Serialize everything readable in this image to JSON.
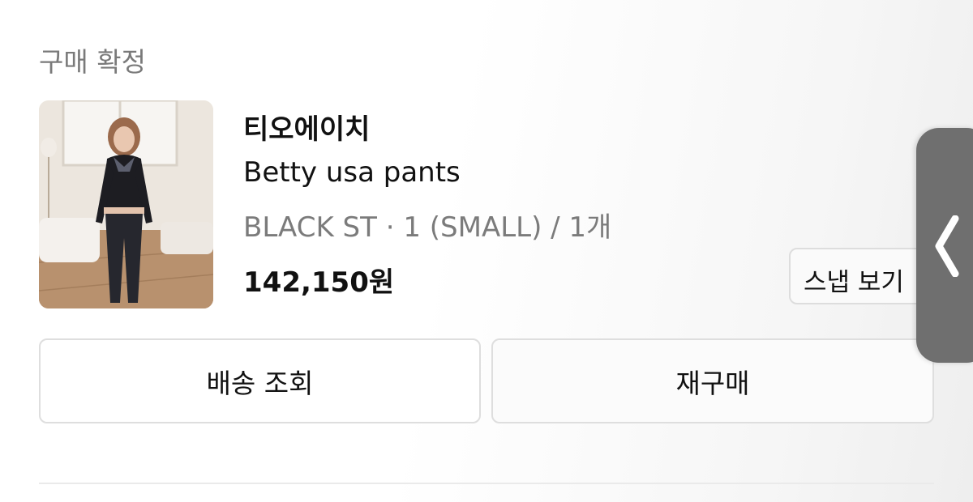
{
  "order": {
    "status_label": "구매 확정"
  },
  "product": {
    "brand": "티오에이치",
    "name": "Betty usa pants",
    "option": "BLACK ST · 1 (SMALL) / 1개",
    "price": "142,150원",
    "image_icon": "product-photo"
  },
  "buttons": {
    "snap": "스냅 보기",
    "delivery": "배송 조회",
    "rebuy": "재구매"
  },
  "side_handle": {
    "icon": "chevron-left-icon"
  }
}
